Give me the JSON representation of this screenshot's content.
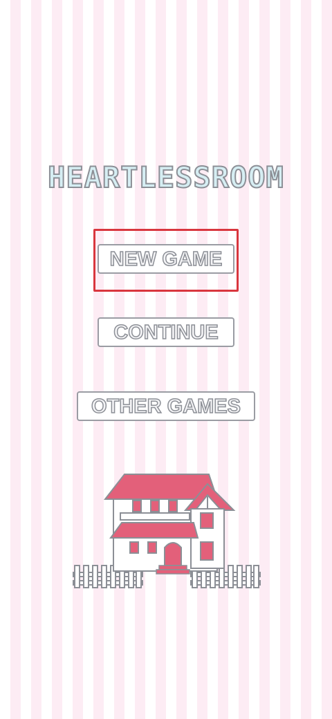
{
  "game": {
    "title": "HEARTLESSROOM"
  },
  "menu": {
    "new_game": "NEW GAME",
    "continue": "CONTINUE",
    "other_games": "OTHER GAMES"
  },
  "colors": {
    "stripe_pink": "#fdecf4",
    "title_fill": "#d6eef3",
    "outline_gray": "#8c8f96",
    "roof_pink": "#e3607a",
    "highlight_red": "#d9363e"
  }
}
